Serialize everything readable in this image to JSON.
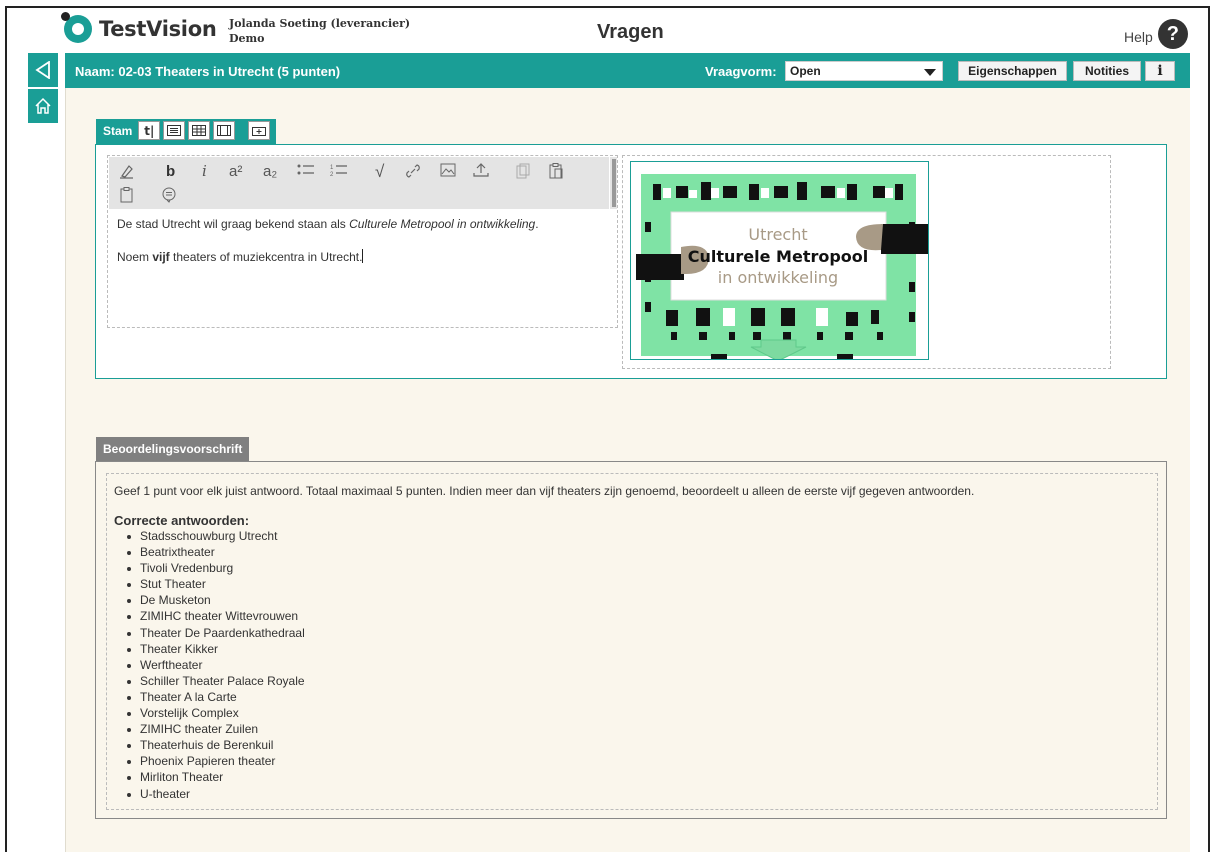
{
  "header": {
    "logo_text": "TestVision",
    "user_name": "Jolanda Soeting (leverancier)",
    "user_org": "Demo",
    "page_title": "Vragen",
    "help_label": "Help",
    "help_icon": "?"
  },
  "rail": {
    "back_icon": "triangle-left-icon",
    "home_icon": "home-icon"
  },
  "topbar": {
    "name_label": "Naam: 02-03 Theaters in Utrecht (5 punten)",
    "vraagvorm_label": "Vraagvorm:",
    "vraagvorm_value": "Open",
    "buttons": {
      "eigenschappen": "Eigenschappen",
      "notities": "Notities",
      "info": "i"
    }
  },
  "stam": {
    "tab_label": "Stam",
    "tab_icons": [
      "text-icon",
      "list-icon",
      "table-icon",
      "frame-icon",
      "add-frame-icon"
    ],
    "toolbar_icons": [
      "eraser-icon",
      "bold-icon",
      "italic-icon",
      "superscript-icon",
      "subscript-icon",
      "bullet-list-icon",
      "numbered-list-icon",
      "sqrt-icon",
      "link-icon",
      "image-icon",
      "upload-icon",
      "copy-icon",
      "paste-icon",
      "paste-text-icon",
      "comment-icon"
    ],
    "toolbar_glyphs": {
      "bold": "b",
      "italic": "i",
      "sup": "a²",
      "sub": "a₂",
      "sqrt": "√"
    },
    "text1_plain": "De stad Utrecht wil graag bekend staan als ",
    "text1_italic": "Culturele Metropool in ontwikkeling",
    "text1_end": ".",
    "text2_start": "Noem ",
    "text2_bold": "vijf",
    "text2_end": " theaters of muziekcentra in Utrecht."
  },
  "image": {
    "line1": "Utrecht",
    "line2": "Culturele Metropool",
    "line3": "in ontwikkeling",
    "bg_color": "#7fe3a5",
    "accent_color": "#a89a86"
  },
  "beoordeling": {
    "tab_label": "Beoordelingsvoorschrift",
    "intro": "Geef 1 punt voor elk juist antwoord. Totaal maximaal 5 punten. Indien meer dan vijf theaters zijn genoemd, beoordeelt u alleen de eerste vijf gegeven antwoorden.",
    "heading": "Correcte antwoorden:",
    "answers": [
      "Stadsschouwburg Utrecht",
      "Beatrixtheater",
      "Tivoli Vredenburg",
      "Stut Theater",
      "De Musketon",
      "ZIMIHC theater Wittevrouwen",
      "Theater De Paardenkathedraal",
      "Theater Kikker",
      "Werftheater",
      "Schiller Theater Palace Royale",
      "Theater A la Carte",
      "Vorstelijk Complex",
      "ZIMIHC theater Zuilen",
      "Theaterhuis de Berenkuil",
      "Phoenix Papieren theater",
      "Mirliton Theater",
      "U-theater"
    ]
  },
  "colors": {
    "accent": "#1a9e96",
    "panel_bg": "#faf6ec",
    "tab_gray": "#808080"
  }
}
